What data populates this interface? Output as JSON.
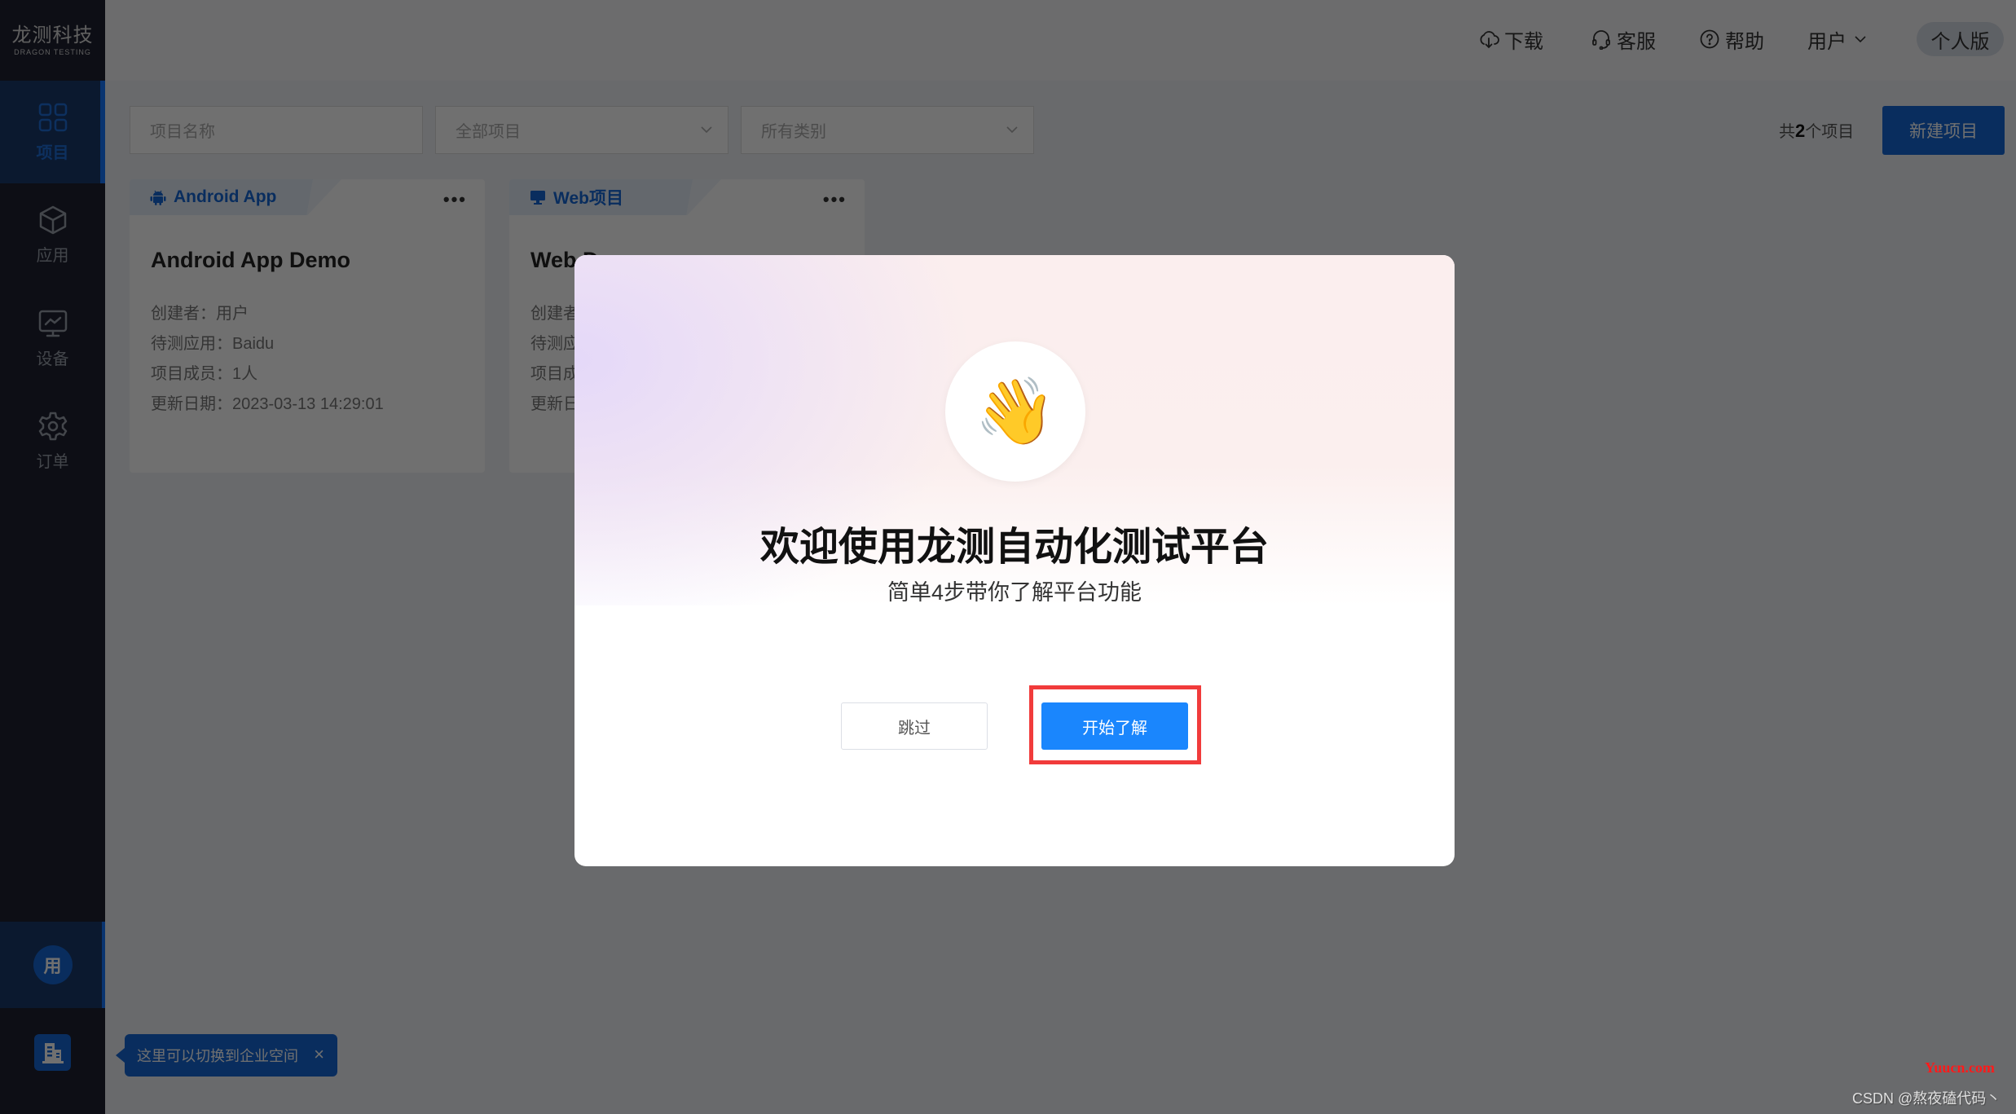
{
  "app": {
    "logo_cn": "龙测科技",
    "logo_en": "DRAGON TESTING"
  },
  "sidebar": {
    "items": [
      {
        "label": "项目",
        "icon": "grid-icon",
        "active": true
      },
      {
        "label": "应用",
        "icon": "cube-icon",
        "active": false
      },
      {
        "label": "设备",
        "icon": "monitor-chart-icon",
        "active": false
      },
      {
        "label": "订单",
        "icon": "gear-icon",
        "active": false
      }
    ],
    "personal_avatar": "用",
    "enterprise_icon": "building-icon"
  },
  "header": {
    "nav": [
      {
        "label": "下载",
        "icon": "cloud-download-icon"
      },
      {
        "label": "客服",
        "icon": "headset-icon"
      },
      {
        "label": "帮助",
        "icon": "question-circle-icon"
      },
      {
        "label": "用户",
        "icon": "chevron-down-icon"
      }
    ],
    "edition": "个人版"
  },
  "filters": {
    "name_placeholder": "项目名称",
    "project_select": "全部项目",
    "category_select": "所有类别",
    "count_prefix": "共",
    "count_value": "2",
    "count_suffix": "个项目",
    "new_button": "新建项目"
  },
  "projects": [
    {
      "type": "Android App",
      "type_icon": "android-icon",
      "name": "Android App Demo",
      "creator": "创建者：用户",
      "app": "待测应用：Baidu",
      "members": "项目成员：1人",
      "updated": "更新日期：2023-03-13 14:29:01"
    },
    {
      "type": "Web项目",
      "type_icon": "monitor-icon",
      "name": "Web D",
      "creator": "创建者",
      "app": "待测应",
      "members": "项目成",
      "updated": "更新日"
    }
  ],
  "tooltip": {
    "text": "这里可以切换到企业空间",
    "close": "×"
  },
  "modal": {
    "emoji": "👋",
    "title": "欢迎使用龙测自动化测试平台",
    "subtitle": "简单4步带你了解平台功能",
    "skip_button": "跳过",
    "start_button": "开始了解",
    "highlight_color": "#f13b3b"
  },
  "watermark": {
    "site": "Yuucn.com",
    "author": "CSDN @熬夜磕代码丶"
  },
  "colors": {
    "primary": "#1668d6",
    "modal_primary": "#1a86fd",
    "sidebar_bg": "#1e2030"
  }
}
